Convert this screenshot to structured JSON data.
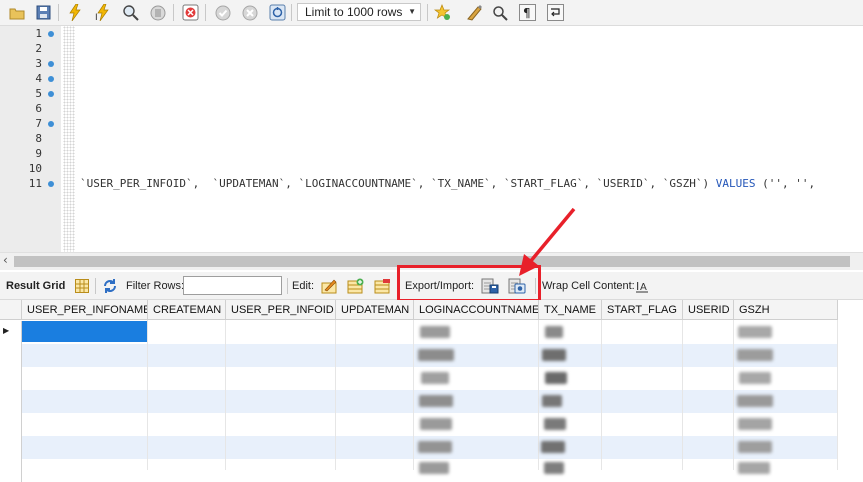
{
  "toolbar": {
    "limit_value": "Limit to 1000 rows",
    "icons": [
      "open-folder-icon",
      "save-icon",
      "execute-icon",
      "execute-current-icon",
      "explain-icon",
      "stop-icon",
      "toggle-error-icon",
      "commit-icon",
      "rollback-icon",
      "autocommit-icon",
      "bookmark-star-icon",
      "beautify-icon",
      "find-icon",
      "invisible-chars-icon",
      "wrap-icon"
    ]
  },
  "editor": {
    "line_numbers": [
      "1",
      "2",
      "3",
      "4",
      "5",
      "6",
      "7",
      "8",
      "9",
      "10",
      "11"
    ],
    "markers": [
      1,
      3,
      4,
      5,
      7,
      11
    ],
    "line11_code": "`USER_PER_INFOID`,  `UPDATEMAN`, `LOGINACCOUNTNAME`, `TX_NAME`, `START_FLAG`, `USERID`, `GSZH`) ",
    "line11_keyword": "VALUES",
    "line11_tail": " ('', '',"
  },
  "result_toolbar": {
    "result_grid_label": "Result Grid",
    "filter_rows_label": "Filter Rows:",
    "filter_rows_value": "",
    "edit_label": "Edit:",
    "export_import_label": "Export/Import:",
    "wrap_label": "Wrap Cell Content:"
  },
  "grid": {
    "columns": [
      "USER_PER_INFONAME",
      "CREATEMAN",
      "USER_PER_INFOID",
      "UPDATEMAN",
      "LOGINACCOUNTNAME",
      "TX_NAME",
      "START_FLAG",
      "USERID",
      "GSZH"
    ],
    "row_count": 7,
    "selected_row": 0
  },
  "colors": {
    "accent": "#1a7ee0",
    "highlight_box": "#e8202a",
    "marker": "#3e8fd6",
    "alt_row": "#e8f0fb"
  }
}
